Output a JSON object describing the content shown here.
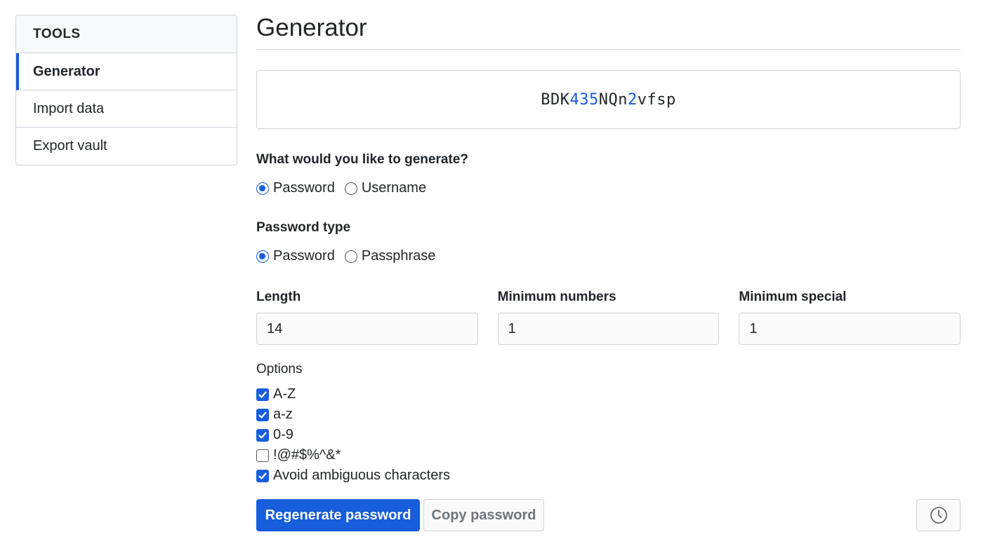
{
  "sidebar": {
    "header": "TOOLS",
    "items": [
      {
        "label": "Generator",
        "active": true
      },
      {
        "label": "Import data",
        "active": false
      },
      {
        "label": "Export vault",
        "active": false
      }
    ]
  },
  "main": {
    "title": "Generator",
    "generated_password": {
      "segments": [
        {
          "text": "BDK",
          "numeric": false
        },
        {
          "text": "435",
          "numeric": true
        },
        {
          "text": "NQn",
          "numeric": false
        },
        {
          "text": "2",
          "numeric": true
        },
        {
          "text": "vfsp",
          "numeric": false
        }
      ]
    },
    "generate_question": "What would you like to generate?",
    "generate_options": [
      {
        "label": "Password",
        "checked": true
      },
      {
        "label": "Username",
        "checked": false
      }
    ],
    "password_type_label": "Password type",
    "password_type_options": [
      {
        "label": "Password",
        "checked": true
      },
      {
        "label": "Passphrase",
        "checked": false
      }
    ],
    "fields": {
      "length": {
        "label": "Length",
        "value": "14"
      },
      "min_numbers": {
        "label": "Minimum numbers",
        "value": "1"
      },
      "min_special": {
        "label": "Minimum special",
        "value": "1"
      }
    },
    "options_label": "Options",
    "options": [
      {
        "label": "A-Z",
        "checked": true
      },
      {
        "label": "a-z",
        "checked": true
      },
      {
        "label": "0-9",
        "checked": true
      },
      {
        "label": "!@#$%^&*",
        "checked": false
      },
      {
        "label": "Avoid ambiguous characters",
        "checked": true
      }
    ],
    "buttons": {
      "regenerate": "Regenerate password",
      "copy": "Copy password",
      "history_icon": "clock-icon"
    }
  },
  "colors": {
    "accent": "#175ddc",
    "border": "#ced4da",
    "text": "#212529",
    "muted": "#6c757d"
  }
}
